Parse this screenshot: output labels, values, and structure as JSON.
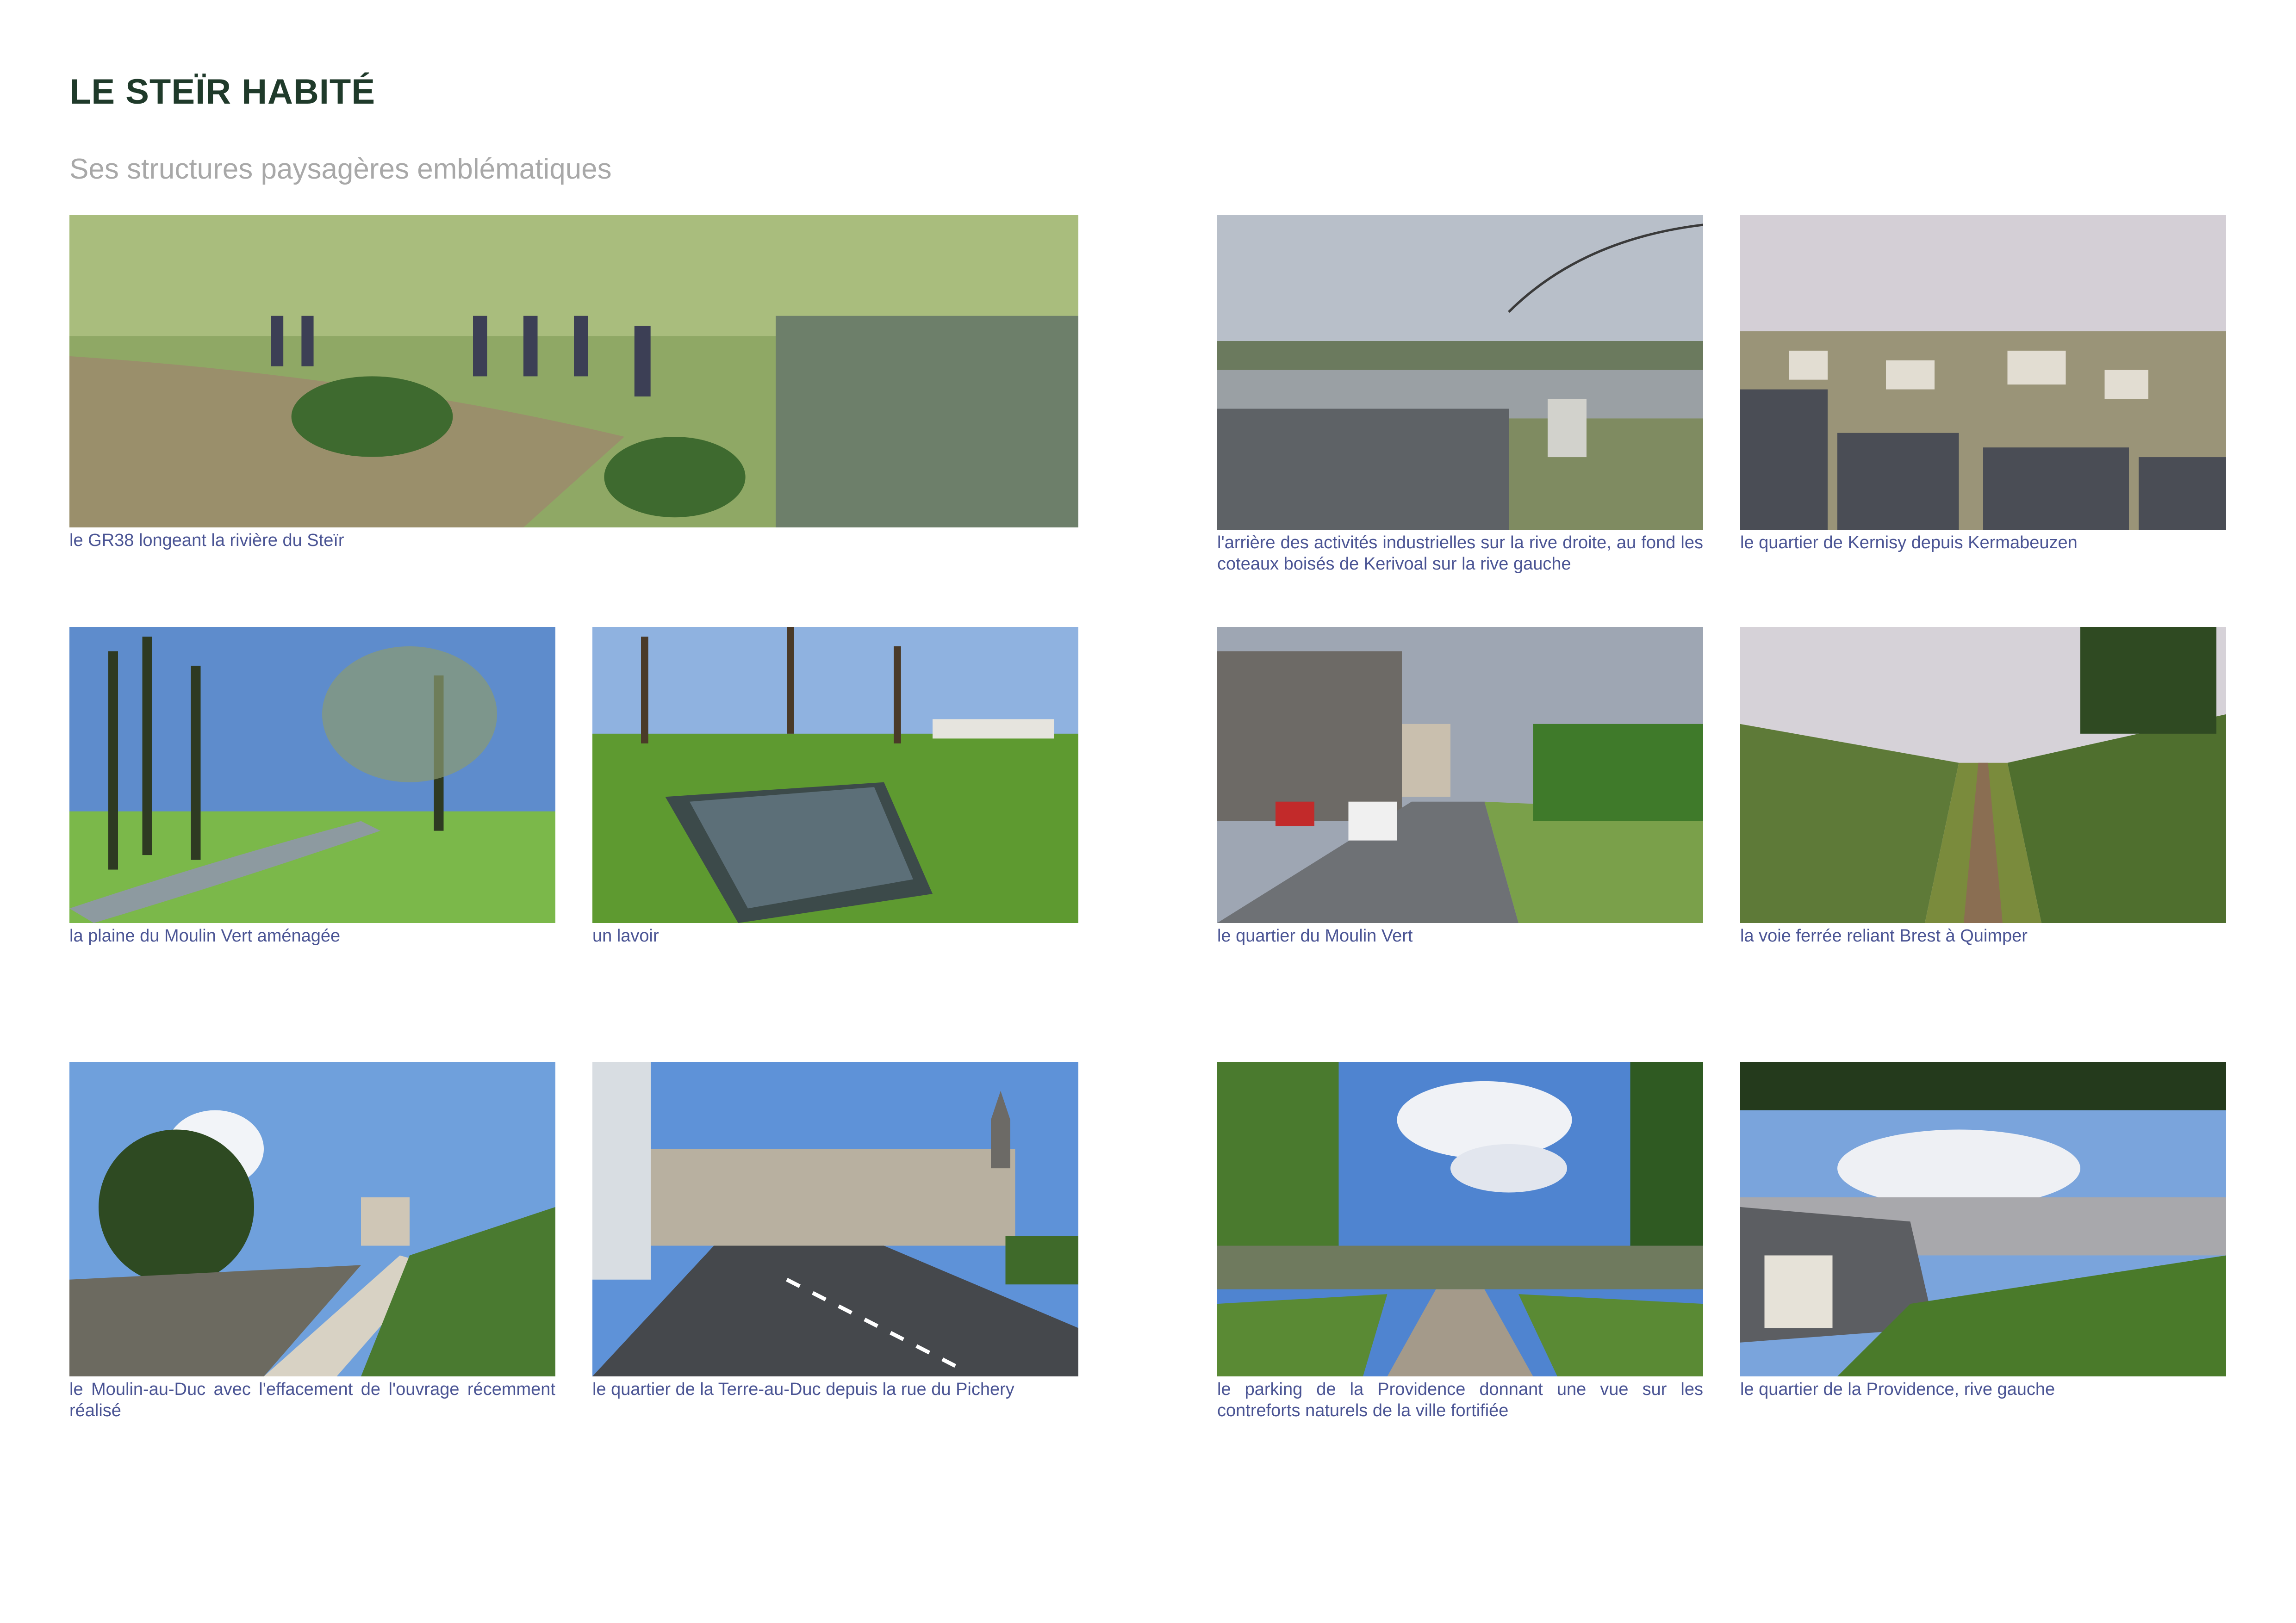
{
  "page": {
    "title": "LE STEÏR HABITÉ",
    "subtitle": "Ses structures paysagères emblématiques"
  },
  "photos": [
    {
      "id": "gr38",
      "caption": "le GR38 longeant la rivière du Steïr"
    },
    {
      "id": "industrial",
      "caption": "l'arrière des activités industrielles sur la rive droite, au fond les coteaux boisés de Kerivoal sur la rive gauche"
    },
    {
      "id": "kernisy",
      "caption": "le quartier de Kernisy depuis Kermabeuzen"
    },
    {
      "id": "plaine",
      "caption": "la plaine du Moulin Vert aménagée"
    },
    {
      "id": "lavoir",
      "caption": "un lavoir"
    },
    {
      "id": "moulin-vert",
      "caption": "le quartier du Moulin Vert"
    },
    {
      "id": "voie-ferree",
      "caption": "la voie ferrée reliant Brest à Quimper"
    },
    {
      "id": "moulin-au-duc",
      "caption": "le Moulin-au-Duc avec l'effacement de l'ouvrage récemment réalisé"
    },
    {
      "id": "terre-au-duc",
      "caption": "le quartier de la Terre-au-Duc depuis la rue du Pichery"
    },
    {
      "id": "parking-providence",
      "caption": "le parking de la Providence donnant une vue sur les contreforts naturels de la ville fortifiée"
    },
    {
      "id": "providence",
      "caption": "le quartier de la Providence, rive gauche"
    }
  ]
}
